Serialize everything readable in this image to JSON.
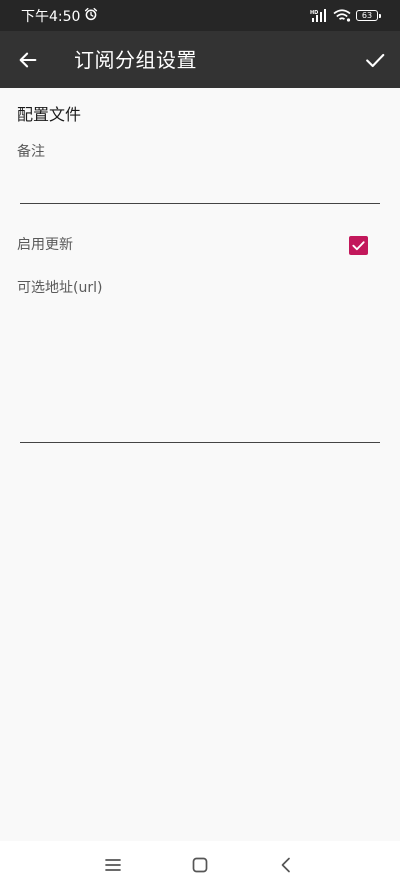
{
  "status_bar": {
    "time": "下午4:50",
    "battery": "63",
    "icons": [
      "alarm-icon",
      "hd-signal-icon",
      "wifi-icon",
      "battery-icon"
    ]
  },
  "app_bar": {
    "title": "订阅分组设置",
    "icons": [
      "back-arrow-icon",
      "check-icon"
    ]
  },
  "form": {
    "section_title": "配置文件",
    "remark_label": "备注",
    "remark_value": "",
    "enable_update_label": "启用更新",
    "enable_update_checked": true,
    "url_label": "可选地址(url)",
    "url_value": ""
  },
  "nav_bar": {
    "icons": [
      "menu-icon",
      "home-icon",
      "back-icon"
    ]
  },
  "colors": {
    "status_bar_bg": "#262626",
    "app_bar_bg": "#333333",
    "page_bg": "#f9f9f9",
    "accent": "#c2185b"
  }
}
